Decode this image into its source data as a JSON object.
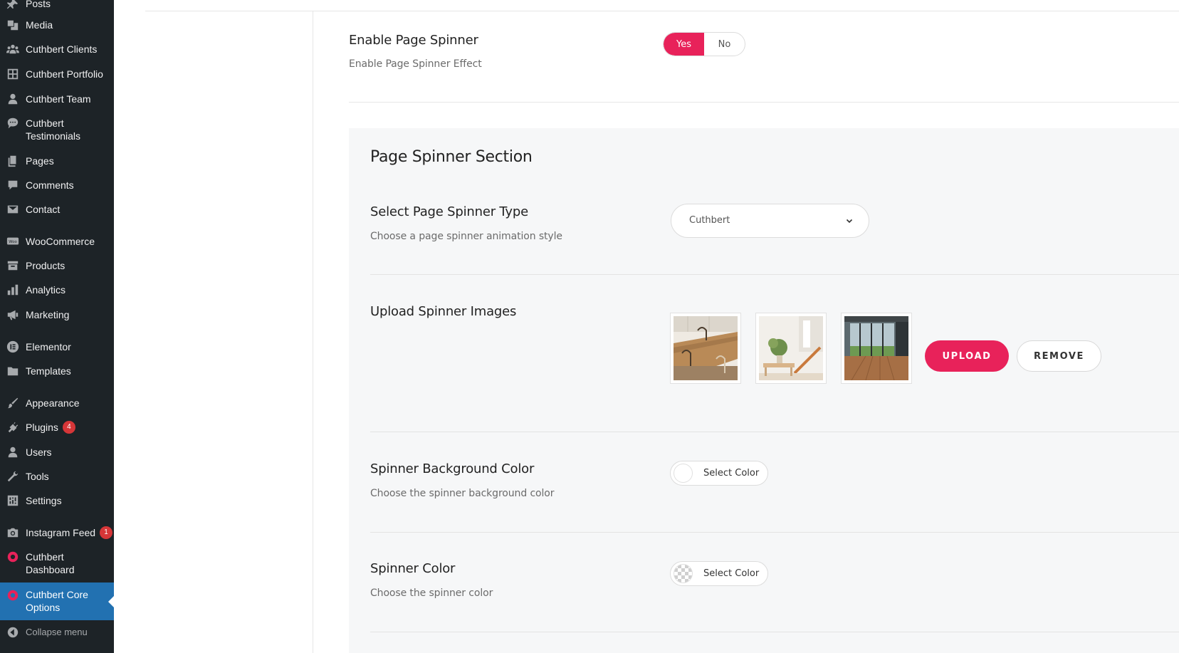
{
  "sidebar": {
    "items": [
      {
        "label": "Posts",
        "icon": "pin-icon"
      },
      {
        "label": "Media",
        "icon": "media-icon"
      },
      {
        "label": "Cuthbert Clients",
        "icon": "groups-icon"
      },
      {
        "label": "Cuthbert Portfolio",
        "icon": "grid-icon"
      },
      {
        "label": "Cuthbert Team",
        "icon": "user-icon"
      },
      {
        "label": "Cuthbert Testimonials",
        "icon": "speech-bubble-icon"
      },
      {
        "label": "Pages",
        "icon": "pages-icon"
      },
      {
        "label": "Comments",
        "icon": "comment-icon"
      },
      {
        "label": "Contact",
        "icon": "mail-icon"
      },
      {
        "label": "WooCommerce",
        "icon": "woo-icon"
      },
      {
        "label": "Products",
        "icon": "archive-icon"
      },
      {
        "label": "Analytics",
        "icon": "bar-chart-icon"
      },
      {
        "label": "Marketing",
        "icon": "megaphone-icon"
      },
      {
        "label": "Elementor",
        "icon": "elementor-icon"
      },
      {
        "label": "Templates",
        "icon": "folder-icon"
      },
      {
        "label": "Appearance",
        "icon": "brush-icon"
      },
      {
        "label": "Plugins",
        "icon": "plugin-icon",
        "badge": "4"
      },
      {
        "label": "Users",
        "icon": "user-icon"
      },
      {
        "label": "Tools",
        "icon": "wrench-icon"
      },
      {
        "label": "Settings",
        "icon": "sliders-icon"
      },
      {
        "label": "Instagram Feed",
        "icon": "camera-icon",
        "badge": "1"
      },
      {
        "label": "Cuthbert Dashboard",
        "icon": "cuthbert-logo-icon"
      },
      {
        "label": "Cuthbert Core Options",
        "icon": "cuthbert-logo-icon",
        "current": true
      },
      {
        "label": "Collapse menu",
        "icon": "collapse-arrow-icon"
      }
    ]
  },
  "enable_spinner": {
    "title": "Enable Page Spinner",
    "description": "Enable Page Spinner Effect",
    "yes_label": "Yes",
    "no_label": "No",
    "value": "Yes"
  },
  "section": {
    "title": "Page Spinner Section",
    "spinner_type": {
      "title": "Select Page Spinner Type",
      "description": "Choose a page spinner animation style",
      "selected": "Cuthbert"
    },
    "spinner_images": {
      "title": "Upload Spinner Images",
      "upload_label": "UPLOAD",
      "remove_label": "REMOVE"
    },
    "bg_color": {
      "title": "Spinner Background Color",
      "description": "Choose the spinner background color",
      "button_label": "Select Color"
    },
    "spinner_color": {
      "title": "Spinner Color",
      "description": "Choose the spinner color",
      "button_label": "Select Color"
    }
  },
  "colors": {
    "sidebar_bg": "#1d2327",
    "sidebar_current": "#2271b1",
    "accent": "#e8225a",
    "badge": "#d63638"
  }
}
